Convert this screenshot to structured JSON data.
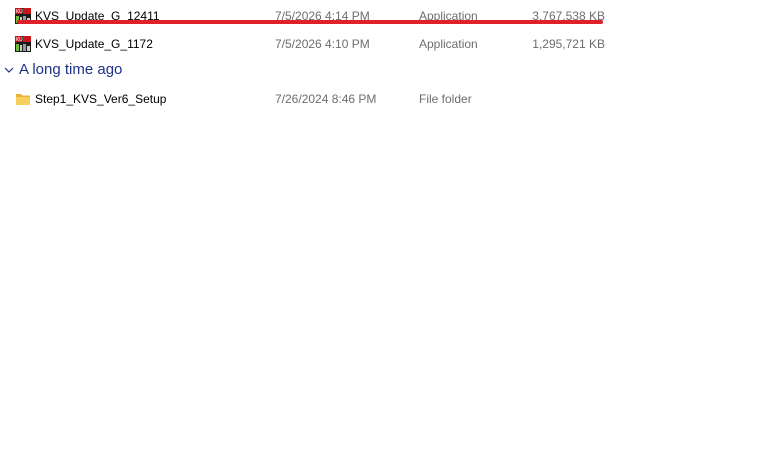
{
  "files": [
    {
      "name": "KVS_Update_G_12411",
      "date_modified": "7/5/2026 4:14 PM",
      "type": "Application",
      "size": "3,767,538 KB",
      "icon": "app-icon"
    },
    {
      "name": "KVS_Update_G_1172",
      "date_modified": "7/5/2026 4:10 PM",
      "type": "Application",
      "size": "1,295,721 KB",
      "icon": "app-icon"
    }
  ],
  "group": {
    "label": "A long time ago",
    "icon": "chevron-down-icon"
  },
  "old_files": [
    {
      "name": "Step1_KVS_Ver6_Setup",
      "date_modified": "7/26/2024 8:46 PM",
      "type": "File folder",
      "size": "",
      "icon": "folder-icon"
    }
  ],
  "colors": {
    "group_header": "#1e3287",
    "annotation_line": "#e0202a",
    "folder": "#f3c74f",
    "secondary_text": "#6d6d6d"
  }
}
